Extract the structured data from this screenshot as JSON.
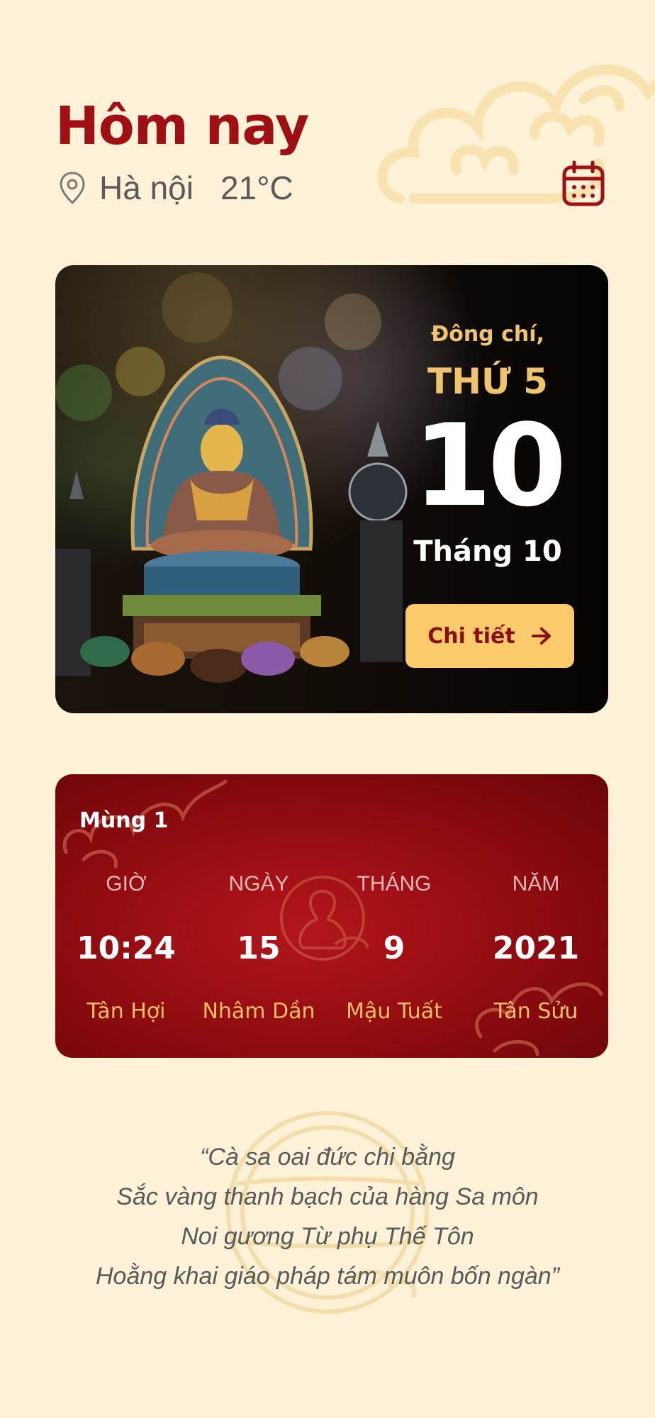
{
  "header": {
    "title": "Hôm nay",
    "location": "Hà nội",
    "temperature": "21°C"
  },
  "hero": {
    "festival": "Đông chí,",
    "weekday": "THỨ 5",
    "day": "10",
    "month": "Tháng 10",
    "detail_label": "Chi tiết"
  },
  "lunar": {
    "label": "Mùng 1",
    "columns": [
      {
        "head": "GIỜ",
        "value": "10:24",
        "can_chi": "Tân Hợi"
      },
      {
        "head": "NGÀY",
        "value": "15",
        "can_chi": "Nhâm Dần"
      },
      {
        "head": "THÁNG",
        "value": "9",
        "can_chi": "Mậu Tuất"
      },
      {
        "head": "NĂM",
        "value": "2021",
        "can_chi": "Tân Sửu"
      }
    ]
  },
  "quote": {
    "lines": [
      "“Cà sa oai đức chi bằng",
      "Sắc vàng thanh bạch của hàng Sa môn",
      "Noi gương Từ phụ Thế Tôn",
      "Hoằng khai giáo pháp tám muôn bốn ngàn”"
    ]
  },
  "colors": {
    "background": "#fdf1d7",
    "brand_red": "#a00f12",
    "gold": "#f0c46a",
    "button_gold": "#fbcb6b"
  },
  "icons": [
    "location-pin-icon",
    "calendar-icon",
    "arrow-right-icon",
    "cloud-decoration",
    "buddha-seal-icon"
  ]
}
